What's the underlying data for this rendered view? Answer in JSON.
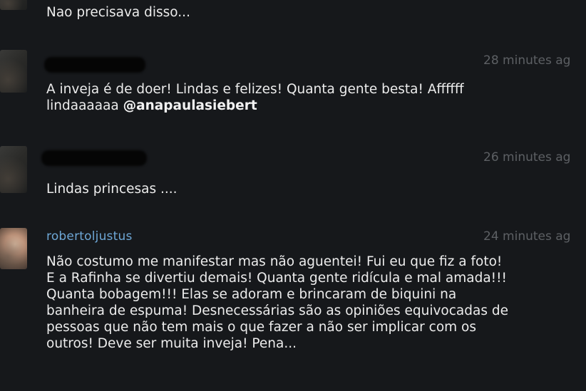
{
  "comments": [
    {
      "username": "",
      "time": "",
      "lines": [
        "Nao precisava disso..."
      ]
    },
    {
      "username": "",
      "time": "28 minutes ag",
      "lines": [
        "A inveja é de doer! Lindas e felizes! Quanta gente besta! Affffff"
      ],
      "line2_prefix": "lindaaaaaa ",
      "mention": "@anapaulasiebert"
    },
    {
      "username": "",
      "time": "26 minutes ag",
      "lines": [
        "Lindas princesas ...."
      ]
    },
    {
      "username": "robertoljustus",
      "time": "24 minutes ag",
      "lines": [
        "Não costumo me manifestar mas não aguentei! Fui eu que fiz a foto!",
        "E a Rafinha se divertiu demais! Quanta gente ridícula e mal amada!!!",
        "Quanta bobagem!!! Elas se adoram e brincaram de biquini na",
        "banheira de espuma! Desnecessárias são as opiniões equivocadas de",
        "pessoas que não tem mais o que fazer a não ser implicar com os",
        "outros! Deve ser muita inveja! Pena..."
      ]
    }
  ]
}
